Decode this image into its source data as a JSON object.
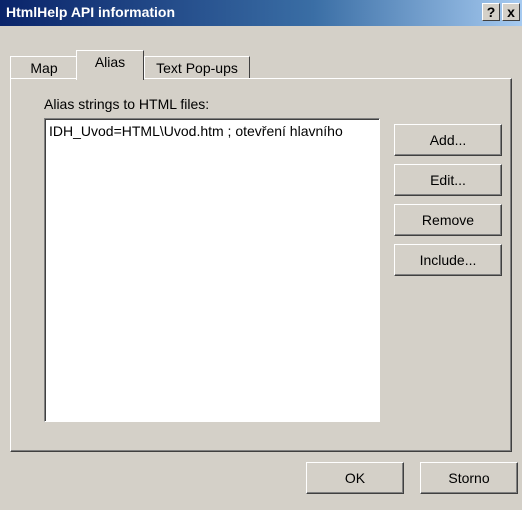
{
  "window": {
    "title": "HtmlHelp API information"
  },
  "titlebar": {
    "help": "?",
    "close": "x"
  },
  "tabs": [
    {
      "label": "Map"
    },
    {
      "label": "Alias",
      "active": true
    },
    {
      "label": "Text Pop-ups"
    }
  ],
  "alias": {
    "label": "Alias strings to HTML files:",
    "items": [
      "IDH_Uvod=HTML\\Uvod.htm ; otevření hlavního"
    ],
    "buttons": {
      "add": "Add...",
      "edit": "Edit...",
      "remove": "Remove",
      "include": "Include..."
    }
  },
  "footer": {
    "ok": "OK",
    "cancel": "Storno"
  }
}
